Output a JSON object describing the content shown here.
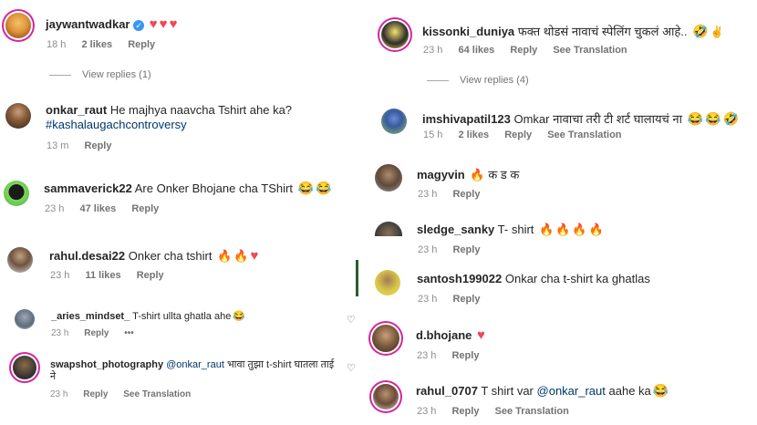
{
  "left": [
    {
      "user": "jaywantwadkar",
      "verified": true,
      "text": "",
      "time": "18 h",
      "likes": "2 likes",
      "reply": "Reply",
      "view_replies": "View replies (1)"
    },
    {
      "user": "onkar_raut",
      "text": "He majhya naavcha Tshirt ahe ka?",
      "hashtag": "#kashalaugachcontroversy",
      "time": "13 m",
      "reply": "Reply"
    },
    {
      "user": "sammaverick22",
      "text": "Are Onker Bhojane cha TShirt",
      "time": "23 h",
      "likes": "47 likes",
      "reply": "Reply"
    },
    {
      "user": "rahul.desai22",
      "text": "Onker cha tshirt",
      "time": "23 h",
      "likes": "11 likes",
      "reply": "Reply"
    },
    {
      "user": "_aries_mindset_",
      "text": "T-shirt ullta ghatla ahe",
      "time": "23 h",
      "reply": "Reply",
      "more": "•••"
    },
    {
      "user": "swapshot_photography",
      "mention": "@onkar_raut",
      "text": "भावा तुझा t-shirt घातला ताई",
      "text2": "ने",
      "time": "23 h",
      "reply": "Reply",
      "translation": "See Translation"
    }
  ],
  "right": [
    {
      "user": "kissonki_duniya",
      "text": "फक्त थोडसं नावाचं स्पेलिंग चुकलं आहे..",
      "time": "23 h",
      "likes": "64 likes",
      "reply": "Reply",
      "translation": "See Translation",
      "view_replies": "View replies (4)"
    },
    {
      "user": "imshivapatil123",
      "text": "Omkar नावाचा तरी टी शर्ट घालायचं ना",
      "time": "15 h",
      "likes": "2 likes",
      "reply": "Reply",
      "translation": "See Translation"
    },
    {
      "user": "magyvin",
      "text": "क ड क",
      "time": "23 h",
      "reply": "Reply"
    },
    {
      "user": "sledge_sanky",
      "text": "T- shirt",
      "time": "23 h",
      "reply": "Reply"
    },
    {
      "user": "santosh199022",
      "text": "Onkar cha t-shirt ka ghatlas",
      "time": "23 h",
      "reply": "Reply"
    },
    {
      "user": "d.bhojane",
      "text": "",
      "time": "23 h",
      "reply": "Reply"
    },
    {
      "user": "rahul_0707",
      "text": "T shirt var",
      "mention": "@onkar_raut",
      "text2": "aahe ka",
      "time": "23 h",
      "reply": "Reply",
      "translation": "See Translation"
    }
  ],
  "icons": {
    "heart": "♥",
    "fire": "🔥",
    "laugh": "😂",
    "grin": "🤣",
    "hand": "✌"
  },
  "colors": {
    "heart": "#ed4956",
    "link": "#00376b",
    "meta": "#8e8e8e"
  }
}
